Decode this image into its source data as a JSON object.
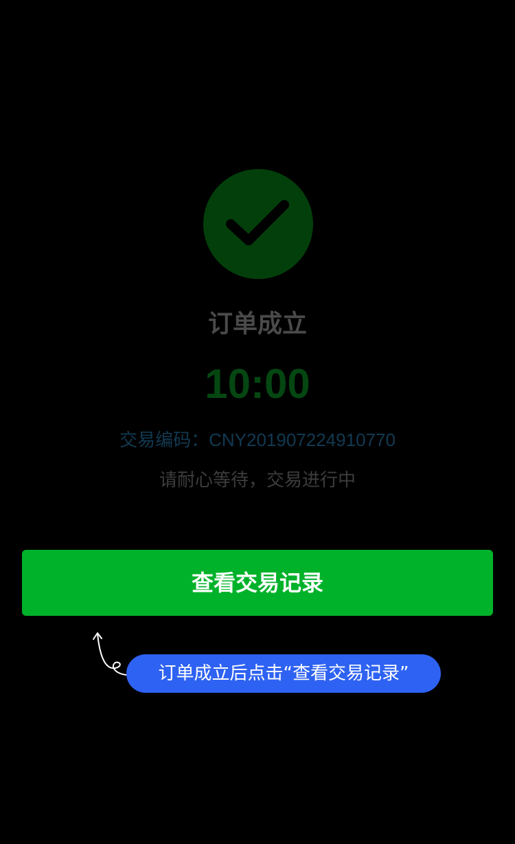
{
  "status": {
    "icon": "check-circle-icon",
    "title": "订单成立"
  },
  "countdown": "10:00",
  "transaction": {
    "label": "交易编码：",
    "code": "CNY201907224910770"
  },
  "hint": "请耐心等待，交易进行中",
  "actions": {
    "view_records_label": "查看交易记录"
  },
  "annotation": {
    "text": "订单成立后点击“查看交易记录”"
  },
  "colors": {
    "background": "#000000",
    "icon_circle": "#033f0b",
    "countdown": "#054712",
    "transaction_code": "#123a52",
    "primary_button": "#00b22a",
    "annotation_bubble": "#2e62f2"
  }
}
